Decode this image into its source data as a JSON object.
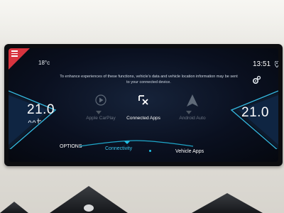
{
  "status": {
    "outside_temp": "18°c",
    "clock": "13:51"
  },
  "info_text": "To enhance experiences of these functions, vehicle's data and vehicle location information may be sent to your connected device.",
  "climate": {
    "left_temp": "21.0",
    "right_temp": "21.0"
  },
  "apps": [
    {
      "label": "Apple CarPlay",
      "state": "disabled"
    },
    {
      "label": "Connected Apps",
      "state": "active"
    },
    {
      "label": "Android Auto",
      "state": "disabled"
    }
  ],
  "bottom_nav": {
    "options": "OPTIONS",
    "connectivity": "Connectivity",
    "vehicle_apps": "Vehicle Apps"
  },
  "colors": {
    "accent": "#22c1e6",
    "menu_badge": "#d8343f",
    "disabled_text": "#6c7583"
  }
}
